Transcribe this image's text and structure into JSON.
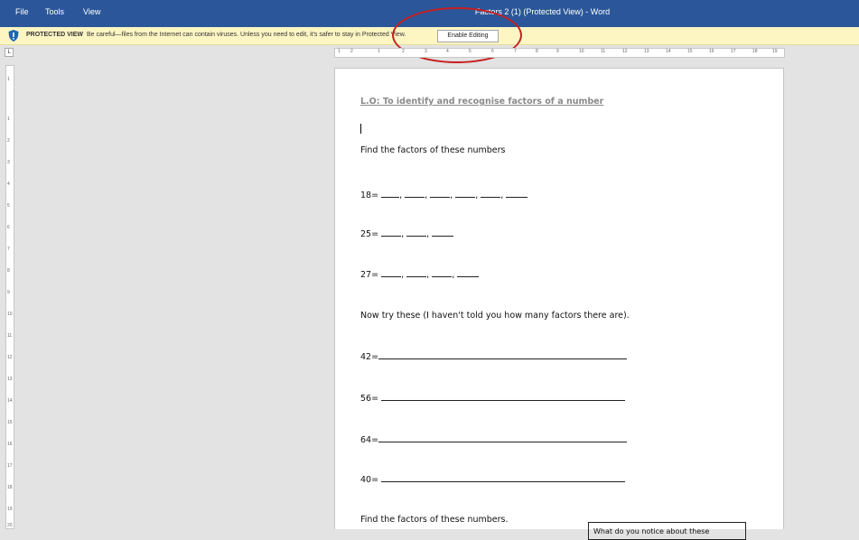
{
  "window": {
    "title": "Factors 2 (1) (Protected View) - Word",
    "menu": [
      "File",
      "Tools",
      "View"
    ]
  },
  "protected_view": {
    "label": "PROTECTED VIEW",
    "message": "Be careful—files from the Internet can contain viruses. Unless you need to edit, it's safer to stay in Protected View.",
    "button": "Enable Editing",
    "annotation_color": "#c81e1e"
  },
  "ruler": {
    "corner": "L",
    "h_labels": [
      "1",
      "2",
      "1",
      "2",
      "3",
      "4",
      "5",
      "6",
      "7",
      "8",
      "9",
      "10",
      "11",
      "12",
      "13",
      "14",
      "15",
      "16",
      "17",
      "18",
      "19"
    ],
    "v_labels": [
      "1",
      "1",
      "2",
      "3",
      "4",
      "5",
      "6",
      "7",
      "8",
      "9",
      "10",
      "11",
      "12",
      "13",
      "14",
      "15",
      "16",
      "17",
      "18",
      "19",
      "20"
    ]
  },
  "document": {
    "lo": "L.O: To identify and recognise factors of a number",
    "instruction1": "Find the factors of these numbers",
    "q1": "18=",
    "q2": "25=",
    "q3": "27=",
    "instruction2": "Now try these (I haven't told you how many factors there are).",
    "q4": "42=",
    "q5": "56=",
    "q6": "64=",
    "q7": "40=",
    "instruction3": "Find the factors of these numbers.",
    "notice_box": "What do you notice about these"
  },
  "colors": {
    "titlebar": "#2b579a",
    "protected_bar": "#fdf6c3"
  }
}
